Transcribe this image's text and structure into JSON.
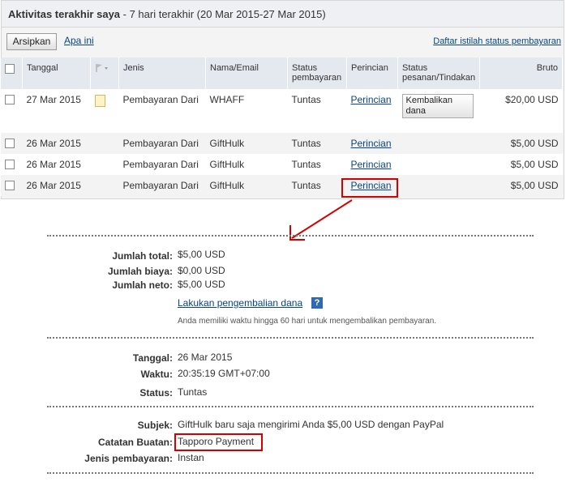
{
  "header": {
    "title": "Aktivitas terakhir saya",
    "subtitle": " - 7 hari terakhir (20 Mar 2015-27 Mar 2015)"
  },
  "toolbar": {
    "archive_label": "Arsipkan",
    "whatis_label": "Apa ini",
    "glossary_link": "Daftar istilah status pembayaran"
  },
  "table": {
    "columns": {
      "date": "Tanggal",
      "type": "Jenis",
      "name": "Nama/Email",
      "status": "Status pembayaran",
      "details": "Perincian",
      "order_status": "Status pesanan/Tindakan",
      "gross": "Bruto"
    },
    "rows": [
      {
        "date": "27 Mar 2015",
        "type": "Pembayaran Dari",
        "name": "WHAFF",
        "status": "Tuntas",
        "details": "Perincian",
        "action": "Kembalikan dana",
        "gross": "$20,00 USD"
      },
      {
        "date": "26 Mar 2015",
        "type": "Pembayaran Dari",
        "name": "GiftHulk",
        "status": "Tuntas",
        "details": "Perincian",
        "action": "",
        "gross": "$5,00 USD"
      },
      {
        "date": "26 Mar 2015",
        "type": "Pembayaran Dari",
        "name": "GiftHulk",
        "status": "Tuntas",
        "details": "Perincian",
        "action": "",
        "gross": "$5,00 USD"
      },
      {
        "date": "26 Mar 2015",
        "type": "Pembayaran Dari",
        "name": "GiftHulk",
        "status": "Tuntas",
        "details": "Perincian",
        "action": "",
        "gross": "$5,00 USD"
      }
    ]
  },
  "details": {
    "total_label": "Jumlah total:",
    "total": "$5,00 USD",
    "fee_label": "Jumlah biaya:",
    "fee": "$0,00 USD",
    "net_label": "Jumlah neto:",
    "net": "$5,00 USD",
    "refund_link": "Lakukan pengembalian dana",
    "help_icon": "?",
    "refund_note": "Anda memiliki waktu hingga 60 hari untuk mengembalikan pembayaran.",
    "date_label": "Tanggal:",
    "date": "26 Mar 2015",
    "time_label": "Waktu:",
    "time": "20:35:19 GMT+07:00",
    "status_label": "Status:",
    "status": "Tuntas",
    "subject_label": "Subjek:",
    "subject": "GiftHulk baru saja mengirimi Anda $5,00 USD dengan PayPal",
    "memo_label": "Catatan Buatan:",
    "memo": "Tapporo Payment",
    "paytype_label": "Jenis pembayaran:",
    "paytype": "Instan"
  },
  "colors": {
    "link": "#084482",
    "highlight": "#d40000"
  }
}
